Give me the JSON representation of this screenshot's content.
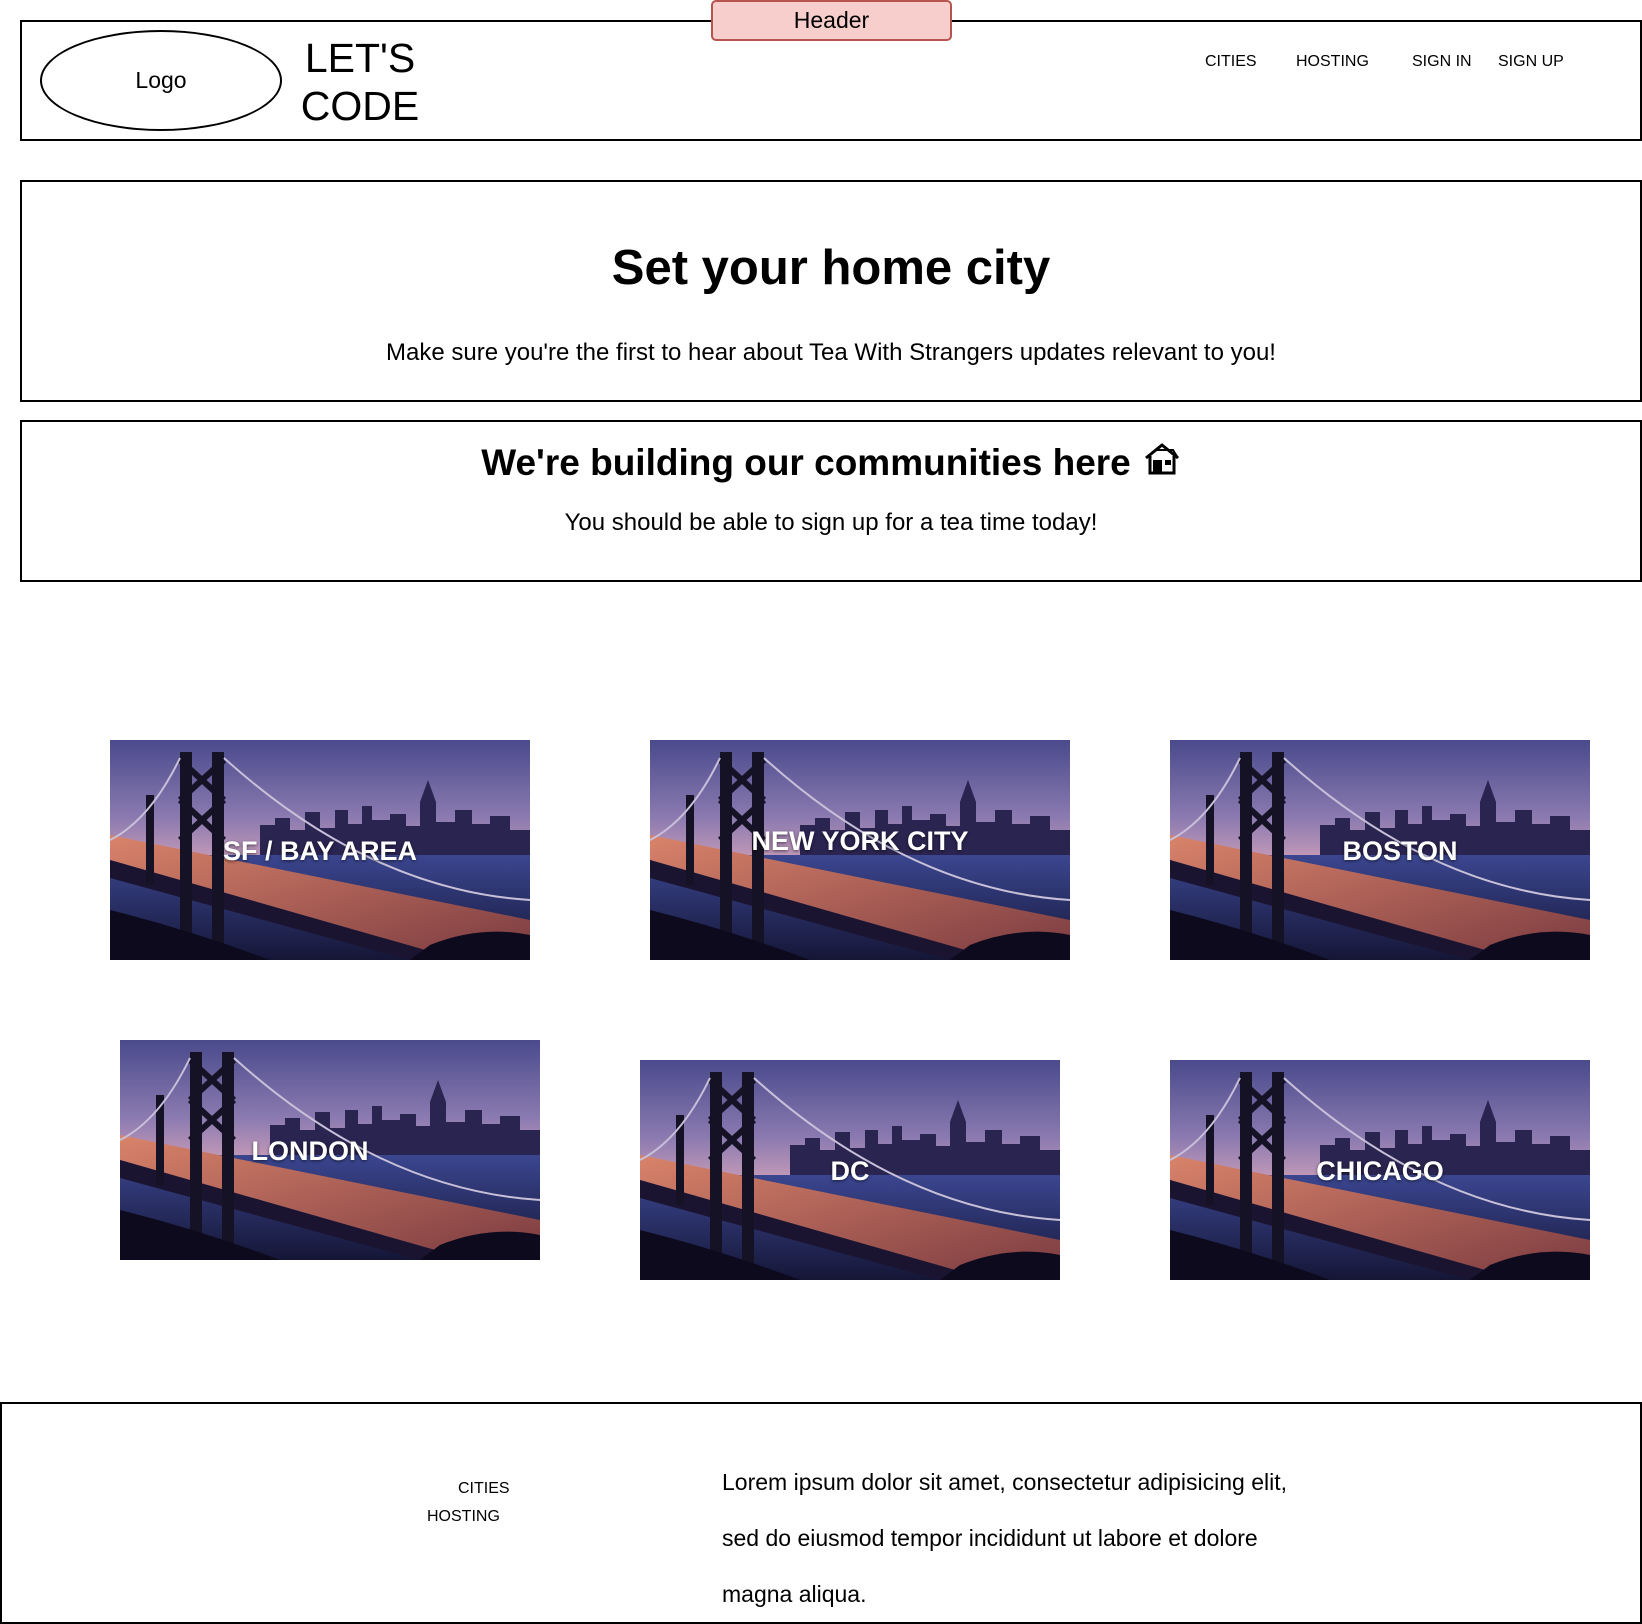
{
  "header": {
    "tag": "Header",
    "logo": "Logo",
    "brand_line1": "LET'S",
    "brand_line2": "CODE",
    "nav": {
      "cities": "CITIES",
      "hosting": "HOSTING",
      "sign_in": "SIGN IN",
      "sign_up": "SIGN UP"
    }
  },
  "intro": {
    "title": "Set your home city",
    "subtitle": "Make sure you're the first to hear about Tea With Strangers updates relevant to you!"
  },
  "communities": {
    "title": "We're building our communities here",
    "icon": "house-icon",
    "subtitle": "You should be able to sign up for a tea time today!"
  },
  "cities": [
    {
      "label": "SF / BAY AREA"
    },
    {
      "label": "NEW YORK CITY"
    },
    {
      "label": "BOSTON"
    },
    {
      "label": "LONDON"
    },
    {
      "label": "DC"
    },
    {
      "label": "CHICAGO"
    }
  ],
  "footer": {
    "links": {
      "cities": "CITIES",
      "hosting": "HOSTING"
    },
    "text": "Lorem ipsum dolor sit amet, consectetur adipisicing elit, sed do eiusmod tempor incididunt ut labore et dolore magna aliqua."
  },
  "colors": {
    "header_tag_fill": "#f8cecc",
    "header_tag_border": "#b85450"
  }
}
